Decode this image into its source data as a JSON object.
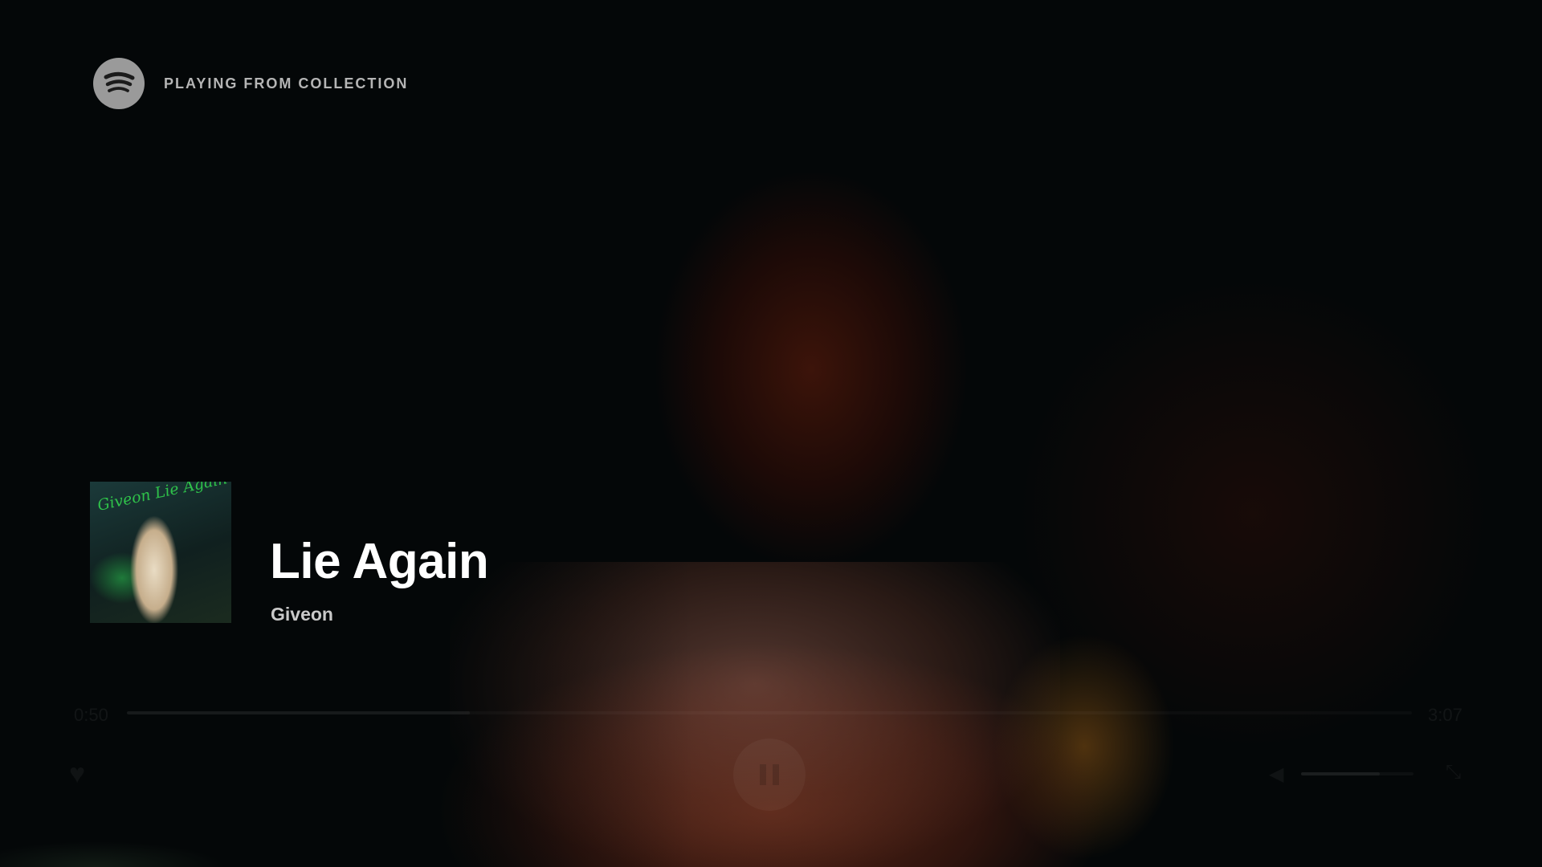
{
  "header": {
    "context_label": "PLAYING FROM COLLECTION",
    "logo_icon": "spotify-logo-icon"
  },
  "now_playing": {
    "cover_icon": "album-cover-image",
    "cover_text": "Giveon Lie Again",
    "title": "Lie Again",
    "artist": "Giveon"
  },
  "player": {
    "elapsed": "0:50",
    "total": "3:07",
    "progress": 0.267,
    "heart_icon": "heart-icon",
    "play_pause_icon": "pause-icon",
    "volume_icon": "volume-icon",
    "volume_level": 0.7,
    "fullscreen_icon": "fullscreen-exit-icon"
  },
  "colors": {
    "background": "#040708",
    "title": "#ffffff",
    "artist": "#c9c9c9",
    "context_label": "#b5b5b5",
    "logo": "#9a9a9a"
  }
}
